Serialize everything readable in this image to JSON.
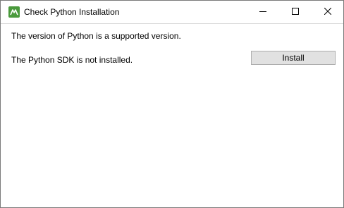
{
  "window": {
    "title": "Check Python Installation",
    "icon": "app-logo-icon",
    "controls": {
      "minimize": "minimize-icon",
      "maximize": "maximize-icon",
      "close": "close-icon"
    }
  },
  "messages": {
    "version_status": "The version of Python is a supported version.",
    "sdk_status": "The Python SDK is not installed."
  },
  "actions": {
    "install_label": "Install"
  },
  "colors": {
    "icon_green": "#4a9a3c",
    "button_face": "#e1e1e1",
    "button_border": "#adadad"
  }
}
